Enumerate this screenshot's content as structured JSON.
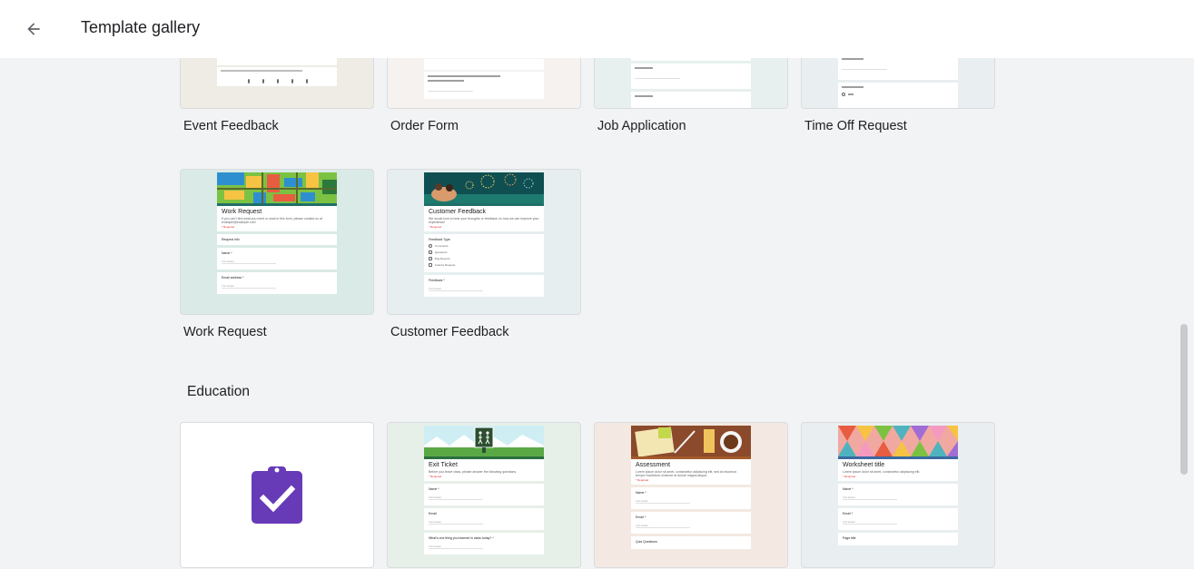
{
  "header": {
    "title": "Template gallery",
    "back_icon": "arrow-back-icon"
  },
  "rows": [
    {
      "labels": [
        "Event Feedback",
        "Order Form",
        "Job Application",
        "Time Off Request"
      ]
    },
    {
      "labels": [
        "Work Request",
        "Customer Feedback"
      ]
    }
  ],
  "work_request": {
    "title": "Work Request",
    "desc": "If you can't find what you need or want in this form, please contact us at example@example.com",
    "req": "* Required",
    "q1": "Request info",
    "q2": "Name *",
    "q3": "Email address *",
    "ans": "Your answer"
  },
  "customer_feedback": {
    "title": "Customer Feedback",
    "desc": "We would love to hear your thoughts or feedback on how we can improve your experience!",
    "req": "* Required",
    "q1": "Feedback Type",
    "opts": [
      "Comments",
      "Questions",
      "Bug Reports",
      "Feature Request"
    ],
    "q2": "Feedback *",
    "ans": "Your answer"
  },
  "education": {
    "section_title": "Education",
    "exit_ticket": {
      "title": "Exit Ticket",
      "desc": "Before you leave class, please answer the following questions.",
      "req": "* Required",
      "q1": "Name *",
      "q2": "Email",
      "q3": "What's one thing you learned in class today? *",
      "ans": "Your answer"
    },
    "assessment": {
      "title": "Assessment",
      "desc": "Lorem ipsum dolor sit amet, consectetur adipiscing elit, sed do eiusmod tempor incididunt ut labore et dolore magna aliqua.",
      "req": "* Required",
      "q1": "Name *",
      "q2": "Email *",
      "q3": "Quiz Questions",
      "ans": "Your answer"
    },
    "worksheet": {
      "title": "Worksheet title",
      "desc": "Lorem ipsum dolor sit amet, consectetur adipiscing elit.",
      "req": "* Required",
      "q1": "Name *",
      "q2": "Email *",
      "q3": "Page title",
      "ans": "Your answer"
    },
    "blank_icon": "assignment-check-icon"
  },
  "colors": {
    "accent_teal": "#1f6f69",
    "purple": "#673ab7"
  }
}
